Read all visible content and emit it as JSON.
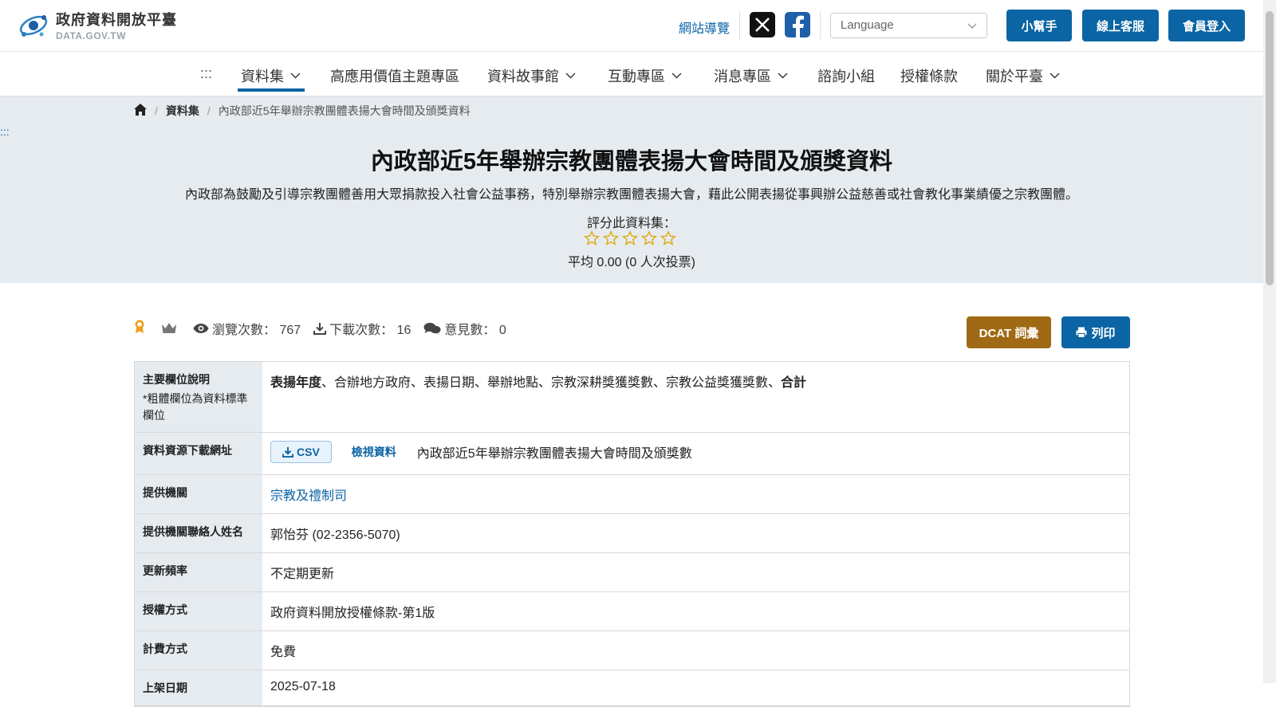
{
  "header": {
    "logo_title": "政府資料開放平臺",
    "logo_sub": "DATA.GOV.TW",
    "sitemap": "網站導覽",
    "language_placeholder": "Language",
    "btn_helper": "小幫手",
    "btn_support": "線上客服",
    "btn_login": "會員登入"
  },
  "nav": {
    "dots": ":::",
    "items": [
      {
        "label": "資料集"
      },
      {
        "label": "高應用價值主題專區"
      },
      {
        "label": "資料故事館"
      },
      {
        "label": "互動專區"
      },
      {
        "label": "消息專區"
      },
      {
        "label": "諮詢小組"
      },
      {
        "label": "授權條款"
      },
      {
        "label": "關於平臺"
      }
    ]
  },
  "breadcrumb": {
    "items": [
      "資料集",
      "內政部近5年舉辦宗教團體表揚大會時間及頒獎資料"
    ]
  },
  "hero": {
    "dots": ":::",
    "title": "內政部近5年舉辦宗教團體表揚大會時間及頒獎資料",
    "description": "內政部為鼓勵及引導宗教團體善用大眾捐款投入社會公益事務，特別舉辦宗教團體表揚大會，藉此公開表揚從事興辦公益慈善或社會教化事業績優之宗教團體。",
    "rate_label": "評分此資料集：",
    "rating_value": 0,
    "rating_max": 5,
    "rate_avg": "平均 0.00 (0 人次投票)"
  },
  "stats": {
    "views": "瀏覽次數： 767",
    "downloads": "下載次數： 16",
    "comments": "意見數： 0",
    "btn_dcat": "DCAT 詞彙",
    "btn_print": "列印"
  },
  "table": {
    "fields_label": "主要欄位說明",
    "fields_note": "*粗體欄位為資料標準欄位",
    "fields": [
      {
        "text": "表揚年度",
        "bold": true
      },
      {
        "text": "、合辦地方政府、表揚日期、舉辦地點、宗教深耕獎獲獎數、宗教公益獎獲獎數、",
        "bold": false
      },
      {
        "text": "合計",
        "bold": true
      }
    ],
    "resource_label": "資料資源下載網址",
    "csv_label": "CSV",
    "view_label": "檢視資料",
    "resource_name": "內政部近5年舉辦宗教團體表揚大會時間及頒獎數",
    "provider_label": "提供機關",
    "provider": "宗教及禮制司",
    "contact_label": "提供機關聯絡人姓名",
    "contact": "郭怡芬 (02-2356-5070)",
    "frequency_label": "更新頻率",
    "frequency": "不定期更新",
    "license_label": "授權方式",
    "license": "政府資料開放授權條款-第1版",
    "fee_label": "計費方式",
    "fee": "免費",
    "date_label": "上架日期",
    "date": "2025-07-18"
  },
  "colors": {
    "primary": "#0b64a3",
    "dcat": "#a06a14",
    "hero_bg": "#e6ebf0",
    "star": "#e0a800"
  }
}
